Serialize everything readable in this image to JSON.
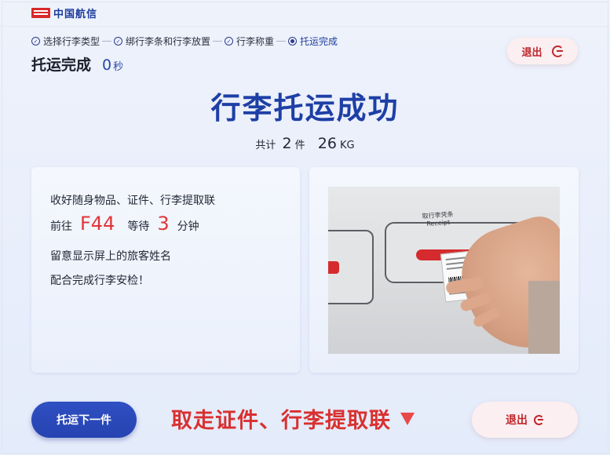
{
  "header": {
    "logo_text": "中国航信"
  },
  "steps": [
    {
      "label": "选择行李类型",
      "state": "done"
    },
    {
      "label": "绑行李条和行李放置",
      "state": "done"
    },
    {
      "label": "行李称重",
      "state": "done"
    },
    {
      "label": "托运完成",
      "state": "current"
    }
  ],
  "status": {
    "title": "托运完成",
    "timer_value": "0",
    "timer_unit": "秒"
  },
  "exit_top_label": "退出",
  "headline": "行李托运成功",
  "summary": {
    "prefix": "共计",
    "count": "2",
    "count_unit": "件",
    "weight": "26",
    "weight_unit": "KG"
  },
  "instructions": {
    "line1": "收好随身物品、证件、行李提取联",
    "line2_prefix": "前往",
    "gate": "F44",
    "line2_mid": "等待",
    "wait_minutes": "3",
    "line2_suffix": "分钟",
    "line3": "留意显示屏上的旅客姓名",
    "line4": "配合完成行李安检！"
  },
  "photo": {
    "receipt_label_cn": "取行李凭条",
    "receipt_label_en": "Receipt"
  },
  "footer": {
    "next_button": "托运下一件",
    "reminder": "取走证件、行李提取联",
    "exit_button": "退出"
  },
  "colors": {
    "brand_blue": "#1e3fa6",
    "accent_red": "#d9302f",
    "exit_bg": "#fbeff1"
  }
}
